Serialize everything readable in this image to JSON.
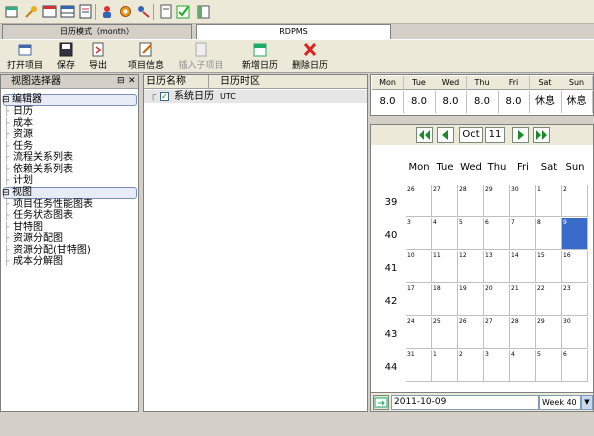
{
  "quick_toolbar": {
    "icons": [
      "new-icon",
      "key-icon",
      "window-icon",
      "grid-icon",
      "users-icon",
      "gear-icon",
      "magic-icon",
      "page-icon",
      "checklist-icon",
      "report-icon"
    ]
  },
  "doc_tabs": [
    {
      "label": "日历模式（month）"
    },
    {
      "label": "RDPMS"
    }
  ],
  "ribbon": {
    "open": "打开项目",
    "save": "保存",
    "export": "导出",
    "project_info": "项目信息",
    "insert_child": "插入子项目",
    "add_calendar": "新增日历",
    "delete_calendar": "删除日历"
  },
  "view_selector": {
    "title": "视图选择器",
    "pin": "⊟",
    "close": "✕",
    "groups": [
      {
        "label": "编辑器",
        "items": [
          "日历",
          "成本",
          "资源",
          "任务",
          "流程关系列表",
          "依赖关系列表",
          "计划"
        ]
      },
      {
        "label": "视图",
        "items": [
          "项目任务性能图表",
          "任务状态图表",
          "甘特图",
          "资源分配图",
          "资源分配(甘特图)",
          "成本分解图"
        ]
      }
    ]
  },
  "calendar_list": {
    "columns": [
      "日历名称",
      "日历时区"
    ],
    "rows": [
      {
        "name": "系统日历",
        "timezone": "UTC",
        "checked": true
      }
    ]
  },
  "work_week": {
    "days": [
      "Mon",
      "Tue",
      "Wed",
      "Thu",
      "Fri",
      "Sat",
      "Sun"
    ],
    "values": [
      "8.0",
      "8.0",
      "8.0",
      "8.0",
      "8.0",
      "休息",
      "休息"
    ]
  },
  "month_nav": {
    "month": "Oct",
    "year": "11"
  },
  "calendar": {
    "weekdays": [
      "Mon",
      "Tue",
      "Wed",
      "Thu",
      "Fri",
      "Sat",
      "Sun"
    ],
    "weeks": [
      {
        "no": "39",
        "days": [
          "26",
          "27",
          "28",
          "29",
          "30",
          "1",
          "2"
        ]
      },
      {
        "no": "40",
        "days": [
          "3",
          "4",
          "5",
          "6",
          "7",
          "8",
          "9"
        ]
      },
      {
        "no": "41",
        "days": [
          "10",
          "11",
          "12",
          "13",
          "14",
          "15",
          "16"
        ]
      },
      {
        "no": "42",
        "days": [
          "17",
          "18",
          "19",
          "20",
          "21",
          "22",
          "23"
        ]
      },
      {
        "no": "43",
        "days": [
          "24",
          "25",
          "26",
          "27",
          "28",
          "29",
          "30"
        ]
      },
      {
        "no": "44",
        "days": [
          "31",
          "1",
          "2",
          "3",
          "4",
          "5",
          "6"
        ]
      }
    ],
    "selected_day": "9"
  },
  "date_bar": {
    "date": "2011-10-09",
    "week": "Week 40"
  },
  "colors": {
    "selected": "#3a6bc8",
    "nav_green": "#1a8a2a"
  }
}
